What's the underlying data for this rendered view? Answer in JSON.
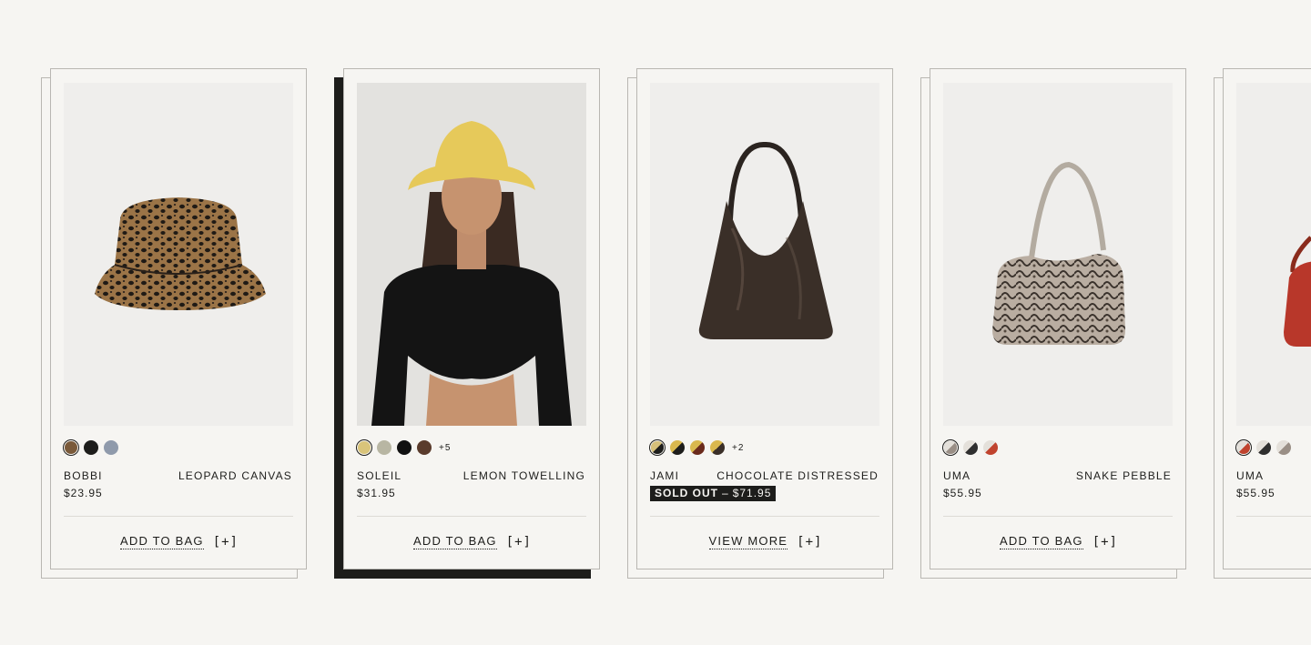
{
  "products": [
    {
      "name": "BOBBI",
      "variant": "LEOPARD CANVAS",
      "price": "$23.95",
      "cta": "ADD TO BAG",
      "cta_icon": "[+]",
      "swatches": [
        "#7a5a3a",
        "#1d1d1b",
        "#8f9aab"
      ],
      "more": "",
      "image": "leopard-bucket-hat"
    },
    {
      "name": "SOLEIL",
      "variant": "LEMON TOWELLING",
      "price": "$31.95",
      "cta": "ADD TO BAG",
      "cta_icon": "[+]",
      "swatches": [
        "#d9c47a",
        "#b8b6a3",
        "#111111",
        "#5a3b2c"
      ],
      "more": "+5",
      "image": "model-yellow-bucket-hat"
    },
    {
      "name": "JAMI",
      "variant": "CHOCOLATE DISTRESSED",
      "sold_out_label": "SOLD OUT",
      "sold_out_sep": "–",
      "price": "$71.95",
      "cta": "VIEW MORE",
      "cta_icon": "[+]",
      "swatches": [
        "#c9a85a",
        "#d9b84e",
        "#8a4a2a",
        "#c7a04a"
      ],
      "more": "+2",
      "image": "chocolate-shoulder-bag"
    },
    {
      "name": "UMA",
      "variant": "SNAKE PEBBLE",
      "price": "$55.95",
      "cta": "ADD TO BAG",
      "cta_icon": "[+]",
      "swatches": [
        "#9a8f86",
        "#5a5a5a",
        "#c0432e"
      ],
      "more": "",
      "image": "snake-shoulder-bag"
    },
    {
      "name": "UMA",
      "variant": "",
      "price": "$55.95",
      "cta": "AD",
      "cta_icon": "",
      "swatches": [
        "#c0432e",
        "#5a5a5a",
        "#9a8f86"
      ],
      "more": "",
      "image": "red-shoulder-bag"
    }
  ]
}
